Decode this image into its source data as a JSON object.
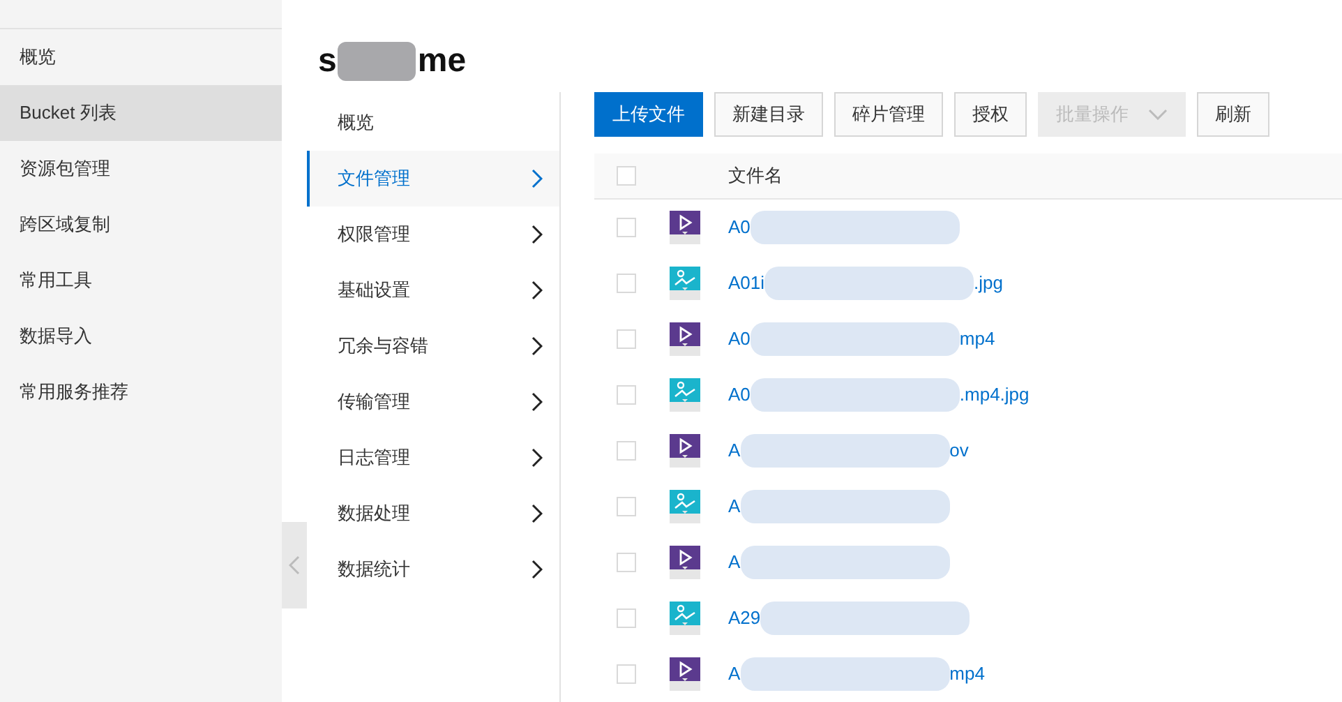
{
  "sidebar": {
    "items": [
      {
        "label": "概览",
        "selected": false
      },
      {
        "label": "Bucket 列表",
        "selected": true
      },
      {
        "label": "资源包管理",
        "selected": false
      },
      {
        "label": "跨区域复制",
        "selected": false
      },
      {
        "label": "常用工具",
        "selected": false
      },
      {
        "label": "数据导入",
        "selected": false
      },
      {
        "label": "常用服务推荐",
        "selected": false
      }
    ]
  },
  "bucket": {
    "title_start": "s",
    "title_end": "me"
  },
  "submenu": {
    "items": [
      {
        "label": "概览",
        "selected": false,
        "expandable": false
      },
      {
        "label": "文件管理",
        "selected": true,
        "expandable": true
      },
      {
        "label": "权限管理",
        "selected": false,
        "expandable": true
      },
      {
        "label": "基础设置",
        "selected": false,
        "expandable": true
      },
      {
        "label": "冗余与容错",
        "selected": false,
        "expandable": true
      },
      {
        "label": "传输管理",
        "selected": false,
        "expandable": true
      },
      {
        "label": "日志管理",
        "selected": false,
        "expandable": true
      },
      {
        "label": "数据处理",
        "selected": false,
        "expandable": true
      },
      {
        "label": "数据统计",
        "selected": false,
        "expandable": true
      }
    ]
  },
  "toolbar": [
    {
      "label": "上传文件",
      "kind": "primary",
      "disabled": false
    },
    {
      "label": "新建目录",
      "kind": "default",
      "disabled": false
    },
    {
      "label": "碎片管理",
      "kind": "default",
      "disabled": false
    },
    {
      "label": "授权",
      "kind": "default",
      "disabled": false
    },
    {
      "label": "批量操作",
      "kind": "dropdown",
      "disabled": true
    },
    {
      "label": "刷新",
      "kind": "default",
      "disabled": false
    }
  ],
  "table": {
    "header_checked": false,
    "columns": [
      "文件名"
    ],
    "rows": [
      {
        "kind": "video",
        "name_start": "A0",
        "name_end": "",
        "checked": false
      },
      {
        "kind": "image",
        "name_start": "A01i",
        "name_end": ".jpg",
        "checked": false
      },
      {
        "kind": "video",
        "name_start": "A0",
        "name_end": "mp4",
        "checked": false
      },
      {
        "kind": "image",
        "name_start": "A0",
        "name_end": ".mp4.jpg",
        "checked": false
      },
      {
        "kind": "video",
        "name_start": "A",
        "name_end": "ov",
        "checked": false
      },
      {
        "kind": "image",
        "name_start": "A",
        "name_end": "",
        "checked": false
      },
      {
        "kind": "video",
        "name_start": "A",
        "name_end": "",
        "checked": false
      },
      {
        "kind": "image",
        "name_start": "A29",
        "name_end": "",
        "checked": false
      },
      {
        "kind": "video",
        "name_start": "A",
        "name_end": "mp4",
        "checked": false
      }
    ]
  }
}
